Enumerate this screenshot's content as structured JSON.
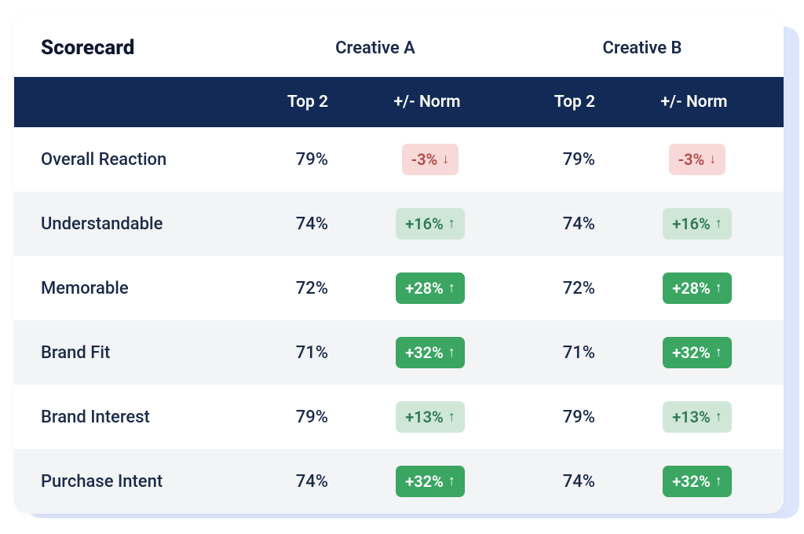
{
  "title": "Scorecard",
  "columns": {
    "creative_a": "Creative A",
    "creative_b": "Creative B",
    "top2": "Top 2",
    "norm": "+/- Norm"
  },
  "rows": [
    {
      "metric": "Overall Reaction",
      "a_top2": "79%",
      "a_norm": "-3%",
      "a_dir": "down",
      "a_style": "neg-light",
      "b_top2": "79%",
      "b_norm": "-3%",
      "b_dir": "down",
      "b_style": "neg-light"
    },
    {
      "metric": "Understandable",
      "a_top2": "74%",
      "a_norm": "+16%",
      "a_dir": "up",
      "a_style": "pos-light",
      "b_top2": "74%",
      "b_norm": "+16%",
      "b_dir": "up",
      "b_style": "pos-light"
    },
    {
      "metric": "Memorable",
      "a_top2": "72%",
      "a_norm": "+28%",
      "a_dir": "up",
      "a_style": "pos-solid",
      "b_top2": "72%",
      "b_norm": "+28%",
      "b_dir": "up",
      "b_style": "pos-solid"
    },
    {
      "metric": "Brand Fit",
      "a_top2": "71%",
      "a_norm": "+32%",
      "a_dir": "up",
      "a_style": "pos-solid",
      "b_top2": "71%",
      "b_norm": "+32%",
      "b_dir": "up",
      "b_style": "pos-solid"
    },
    {
      "metric": "Brand Interest",
      "a_top2": "79%",
      "a_norm": "+13%",
      "a_dir": "up",
      "a_style": "pos-light",
      "b_top2": "79%",
      "b_norm": "+13%",
      "b_dir": "up",
      "b_style": "pos-light"
    },
    {
      "metric": "Purchase Intent",
      "a_top2": "74%",
      "a_norm": "+32%",
      "a_dir": "up",
      "a_style": "pos-solid",
      "b_top2": "74%",
      "b_norm": "+32%",
      "b_dir": "up",
      "b_style": "pos-solid"
    }
  ],
  "chart_data": {
    "type": "table",
    "title": "Scorecard",
    "groups": [
      "Creative A",
      "Creative B"
    ],
    "sub_columns": [
      "Top 2",
      "+/- Norm"
    ],
    "metrics": [
      "Overall Reaction",
      "Understandable",
      "Memorable",
      "Brand Fit",
      "Brand Interest",
      "Purchase Intent"
    ],
    "data": {
      "Creative A": {
        "Top 2": [
          79,
          74,
          72,
          71,
          79,
          74
        ],
        "+/- Norm": [
          -3,
          16,
          28,
          32,
          13,
          32
        ]
      },
      "Creative B": {
        "Top 2": [
          79,
          74,
          72,
          71,
          79,
          74
        ],
        "+/- Norm": [
          -3,
          16,
          28,
          32,
          13,
          32
        ]
      }
    },
    "unit": "percent"
  }
}
